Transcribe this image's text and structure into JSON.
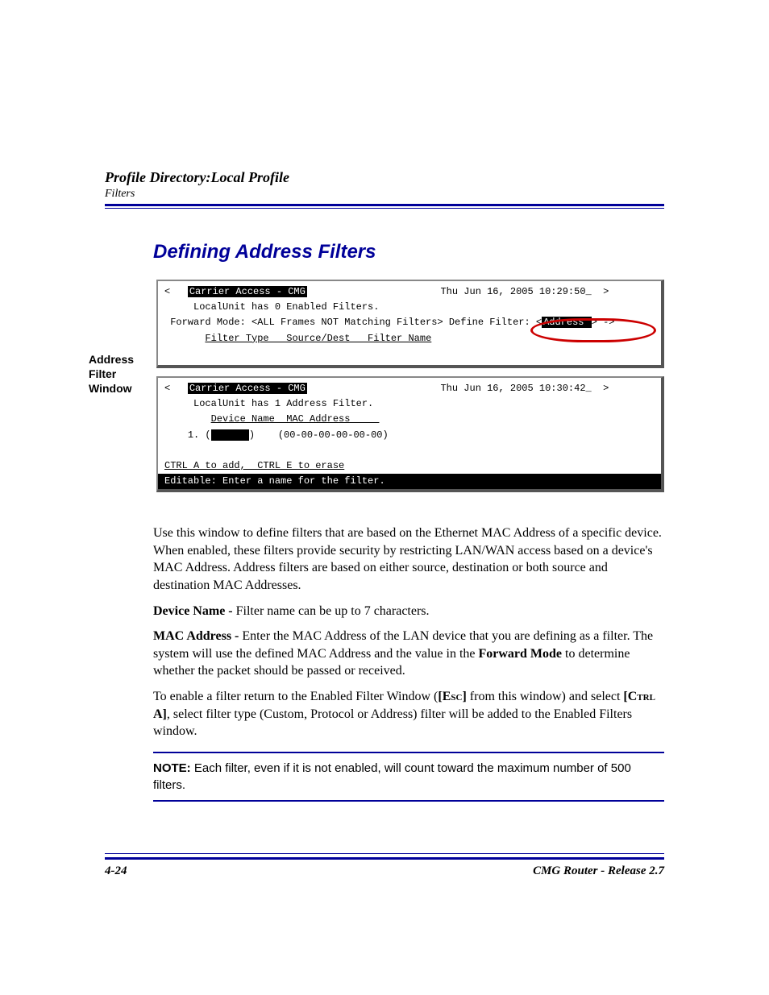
{
  "header": {
    "title": "Profile Directory:Local Profile",
    "sub": "Filters"
  },
  "section_title": "Defining Address Filters",
  "side_label": "Address Filter Window",
  "term1": {
    "title_inv": "Carrier Access - CMG",
    "timestamp": "Thu Jun 16, 2005 10:29:50_",
    "line2": "LocalUnit has 0 Enabled Filters.",
    "fwd_prefix": "Forward Mode: <ALL Frames NOT Matching Filters> Define Filter: <",
    "fwd_inv": "Address ",
    "fwd_suffix": "> ->",
    "cols": "Filter Type   Source/Dest   Filter Name"
  },
  "term2": {
    "title_inv": "Carrier Access - CMG",
    "timestamp": "Thu Jun 16, 2005 10:30:42_",
    "line2": "LocalUnit has 1 Address Filter.",
    "cols": "Device Name  MAC Address     ",
    "row_prefix": "1. (",
    "row_field": "      ",
    "row_suffix": ")    (00-00-00-00-00-00)",
    "help1": "CTRL A to add,  CTRL E to erase",
    "help2": "Editable: Enter a name for the filter.                              "
  },
  "body": {
    "p1": "Use this window to define filters that are based on the Ethernet MAC Address of a specific device. When enabled, these filters provide security by restricting LAN/WAN access based on a device's MAC Address. Address filters are based on either source, destination or both source and destination MAC Addresses.",
    "p2_label": "Device Name - ",
    "p2_text": "Filter name can be up to 7 characters.",
    "p3_label": "MAC Address  - ",
    "p3_text_a": "Enter the MAC Address of the LAN device that you are defining as a filter. The system will use the defined MAC Address and the value in the ",
    "p3_bold": "Forward Mode",
    "p3_text_b": " to determine whether the packet should be passed or received.",
    "p4_a": "To enable a filter return to the Enabled Filter Window (",
    "p4_esc": "[Esc]",
    "p4_b": " from this window) and select ",
    "p4_ctrl": "[Ctrl A]",
    "p4_c": ", select filter type (Custom, Protocol or Address) filter will be added to the Enabled Filters window."
  },
  "note": {
    "label": "NOTE:  ",
    "text": "Each filter, even if it is not enabled, will count toward the maximum number of 500 filters."
  },
  "footer": {
    "page": "4-24",
    "product": "CMG Router - Release 2.7"
  }
}
